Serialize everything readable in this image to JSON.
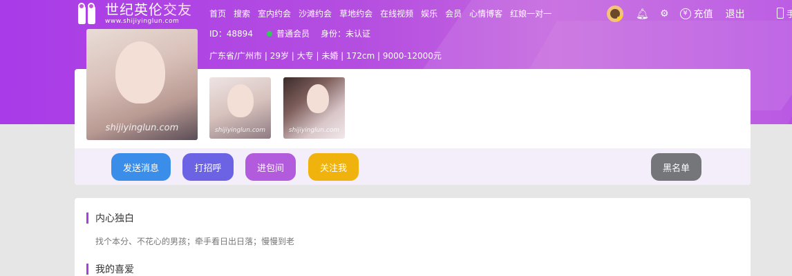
{
  "header": {
    "logo_cn_main": "世纪英伦",
    "logo_cn_accent": "交友",
    "logo_url": "www.shijiyinglun.com",
    "nav": [
      "首页",
      "搜索",
      "室内约会",
      "沙滩约会",
      "草地约会",
      "在线视频",
      "娱乐",
      "会员",
      "心情博客",
      "红娘一对一"
    ],
    "recharge": "充值",
    "logout": "退出",
    "phone_cut": "手"
  },
  "profile": {
    "id_text": "ID：48894",
    "member_level": "普通会员",
    "identity": "身份：未认证",
    "details": "广东省/广州市 | 29岁 | 大专 | 未婚 | 172cm | 9000-12000元",
    "watermark": "shijiyinglun.com"
  },
  "actions": {
    "send_message": "发送消息",
    "greet": "打招呼",
    "private_room": "进包间",
    "follow": "关注我",
    "blacklist": "黑名单"
  },
  "sections": {
    "monologue_title": "内心独白",
    "monologue_text": "找个本分、不花心的男孩；牵手看日出日落；慢慢到老",
    "hobbies_title": "我的喜爱"
  },
  "colors": {
    "banner": "#b44ee0",
    "send": "#3a8de8",
    "greet": "#6b63e3",
    "room": "#b25cdd",
    "follow": "#f0b20c",
    "block": "#75767a",
    "online_dot": "#34c759"
  },
  "icons": [
    "logo-icon",
    "user-avatar",
    "bell-icon",
    "gear-icon",
    "yen-icon",
    "phone-icon"
  ]
}
